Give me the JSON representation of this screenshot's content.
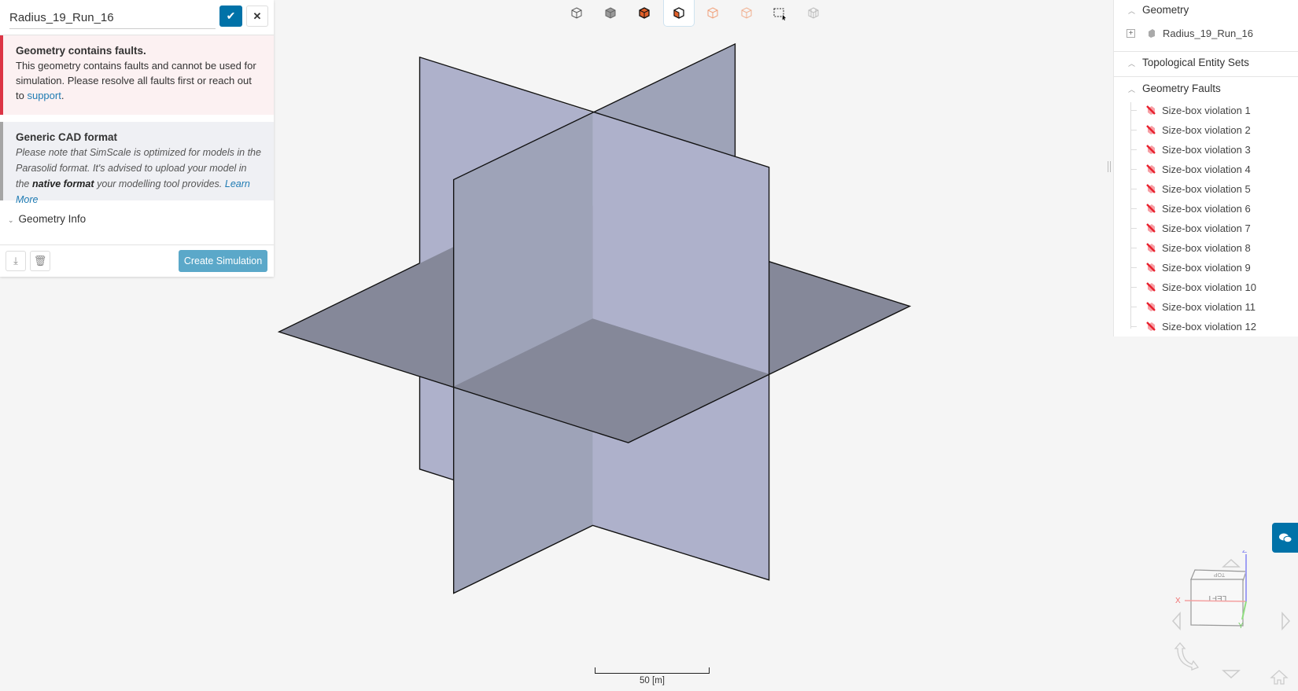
{
  "header": {
    "geometry_name": "Radius_19_Run_16",
    "confirm_icon": "check-icon",
    "cancel_icon": "close-icon"
  },
  "error_alert": {
    "title": "Geometry contains faults.",
    "body": "This geometry contains faults and cannot be used for simulation. Please resolve all faults first or reach out to",
    "link": "support",
    "end": "."
  },
  "info_alert": {
    "title": "Generic CAD format",
    "body1": "Please note that SimScale is optimized for models in the Parasolid format. It's advised to upload your model in the",
    "bold": "native format",
    "body2": "your modelling tool provides.",
    "link": "Learn More"
  },
  "geometry_info": {
    "label": "Geometry Info"
  },
  "footer": {
    "create_label": "Create Simulation"
  },
  "toolbar": [
    "wireframe-view",
    "solid-view",
    "select-volumes",
    "select-faces",
    "select-edges",
    "select-vertices",
    "box-select",
    "hide-show"
  ],
  "tree": {
    "geometry_header": "Geometry",
    "geometry_item": "Radius_19_Run_16",
    "topo_header": "Topological Entity Sets",
    "faults_header": "Geometry Faults",
    "faults": [
      "Size-box violation 1",
      "Size-box violation 2",
      "Size-box violation 3",
      "Size-box violation 4",
      "Size-box violation 5",
      "Size-box violation 6",
      "Size-box violation 7",
      "Size-box violation 8",
      "Size-box violation 9",
      "Size-box violation 10",
      "Size-box violation 11",
      "Size-box violation 12"
    ]
  },
  "scale_bar": {
    "label": "50 [m]"
  },
  "nav_cube": {
    "top": "TOP",
    "left": "LEFT",
    "x": "X",
    "y": "Y",
    "z": "Z"
  },
  "colors": {
    "accent": "#0072a8",
    "error": "#dc3545",
    "fault_icon": "#e8202e"
  }
}
